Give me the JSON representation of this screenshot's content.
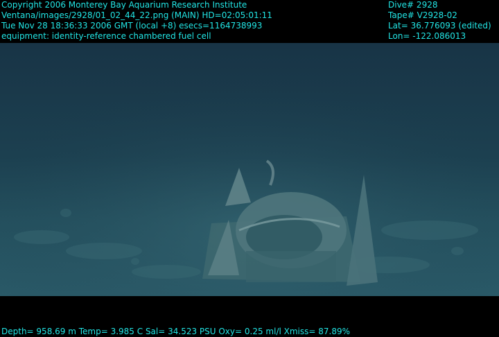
{
  "header_left": [
    "Copyright 2006 Monterey Bay Aquarium Research Institute",
    "Ventana/images/2928/01_02_44_22.png (MAIN)  HD=02:05:01:11",
    "Tue Nov 28 18:36:33 2006 GMT (local +8)  esecs=1164738993",
    "equipment: identity-reference chambered fuel cell"
  ],
  "header_right": [
    "Dive# 2928",
    "Tape# V2928-02",
    "Lat= 36.776093 (edited)",
    "Lon= -122.086013"
  ],
  "footer": "Depth= 958.69 m  Temp= 3.985 C  Sal= 34.523 PSU  Oxy= 0.25 ml/l  Xmiss= 87.89%",
  "colors": {
    "overlay_text": "#22e6e6",
    "water": "#1c4050",
    "seafloor": "#2a5a68",
    "equipment": "#5a7e84"
  }
}
